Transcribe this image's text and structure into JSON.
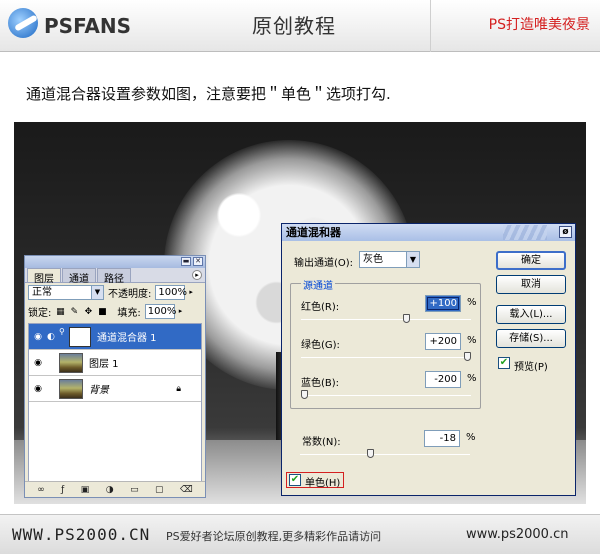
{
  "header": {
    "logo_text": "PSFANS",
    "title": "原创教程",
    "tagline": "PS打造唯美夜景"
  },
  "instruction": "通道混合器设置参数如图，注意要把＂单色＂选项打勾.",
  "layers_panel": {
    "tabs": [
      "图层",
      "通道",
      "路径"
    ],
    "blend_mode": "正常",
    "opacity_label": "不透明度:",
    "opacity_value": "100%",
    "lock_label": "锁定:",
    "fill_label": "填充:",
    "fill_value": "100%",
    "layers": [
      {
        "name": "通道混合器 1",
        "selected": true
      },
      {
        "name": "图层 1",
        "selected": false
      },
      {
        "name": "背景",
        "selected": false
      }
    ]
  },
  "dialog": {
    "title": "通道混和器",
    "output_channel_label": "输出通道(O):",
    "output_channel_value": "灰色",
    "source_group_label": "源通道",
    "channels": [
      {
        "label": "红色(R):",
        "value": "+100",
        "fraction": 0.625
      },
      {
        "label": "绿色(G):",
        "value": "+200",
        "fraction": 1.0
      },
      {
        "label": "蓝色(B):",
        "value": "-200",
        "fraction": 0.0
      }
    ],
    "constant_label": "常数(N):",
    "constant_value": "-18",
    "constant_fraction": 0.41,
    "percent": "%",
    "buttons": {
      "ok": "确定",
      "cancel": "取消",
      "load": "载入(L)...",
      "save": "存储(S)..."
    },
    "preview_label": "预览(P)",
    "preview_checked": true,
    "monochrome_label": "单色(H)",
    "monochrome_checked": true
  },
  "footer": {
    "left": "WWW.PS2000.CN",
    "middle": "PS爱好者论坛原创教程,更多精彩作品请访问",
    "right": "www.ps2000.cn"
  }
}
